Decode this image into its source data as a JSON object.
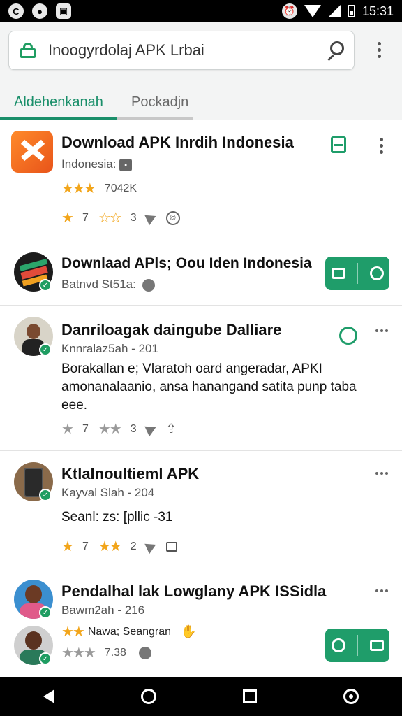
{
  "status_bar": {
    "left_icons": [
      "C",
      "●",
      "▣"
    ],
    "time": "15:31"
  },
  "search": {
    "text": "Inoogyrdolaj APK Lrbai",
    "left_icon": "store-icon",
    "right_icon": "search-icon"
  },
  "tabs": [
    {
      "label": "Aldehenkanah",
      "active": true
    },
    {
      "label": "Pockadjn",
      "active": false
    }
  ],
  "items": [
    {
      "title": "Download APK Inrdih Indonesia",
      "meta": "Indonesia:",
      "stars_text": "7042K",
      "stat1": "7",
      "stat2": "3"
    },
    {
      "title": "Downlaad APls; Oou Iden Indonesia",
      "meta": "Batnvd St51a:"
    },
    {
      "title": "Danriloagak daingube Dalliare",
      "meta": "Knnralaz5ah - 201",
      "body": "Borakallan e; Vlaratoh oard angeradar, APKI amonanalaanio, ansa hanangand satita punp taba eee.",
      "stat1": "7",
      "stat2": "3"
    },
    {
      "title": "Ktlalnoultieml APK",
      "meta": "Kayval Slah - 204",
      "body": "Seanl: zs: [pllic -31",
      "stat1": "7",
      "stat2": "2"
    },
    {
      "title": "Pendalhal lak Lowglany APK ISSidla",
      "meta": "Bawm2ah - 216",
      "sub": "Nawa; Seangran",
      "stat1": "7.38"
    }
  ],
  "colors": {
    "accent": "#1a8f6a",
    "star": "#f2a51a",
    "button": "#1f9d6a"
  }
}
